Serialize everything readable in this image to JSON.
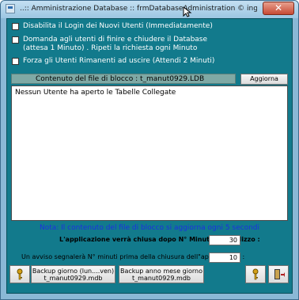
{
  "window": {
    "title": "..:: Amministrazione Database :: frmDatabaseAdministration © ing. Carlo Sca",
    "close_label": "✕"
  },
  "options": {
    "disable_login_label": "Disabilita il Login dei Nuovi Utenti (Immediatamente)",
    "ask_users_label": "Domanda agli utenti di finire e chiudere il Database (attesa 1 Minuto) . Ripeti la richiesta ogni Minuto",
    "force_exit_label": "Forza gli Utenti Rimanenti ad uscire  (Attendi 2 Minuti)"
  },
  "lock_panel": {
    "header": "Contenuto del file di blocco :    t_manut0929.LDB",
    "refresh_label": "Aggiorna",
    "content": "Nessun Utente ha aperto le Tabelle Collegate"
  },
  "note": "Nota: Il contenuto del file di blocco si aggiorna ogni 5 secondi",
  "settings": {
    "close_after_label": "L'applicazione verrà chiusa dopo N° Minuti di inutilizzo :",
    "close_after_value": "30",
    "warn_before_label": "Un avviso segnalerà N° minuti prima della chiusura dell\"applicazione :",
    "warn_before_value": "10"
  },
  "buttons": {
    "backup_weekday": "Backup giorno (lun....ven)\nt_manut0929.mdb",
    "backup_date": "Backup anno mese giorno\nt_manut0929.mdb"
  },
  "colors": {
    "client_bg": "#127a8c",
    "note_text": "#1e2fe0"
  }
}
